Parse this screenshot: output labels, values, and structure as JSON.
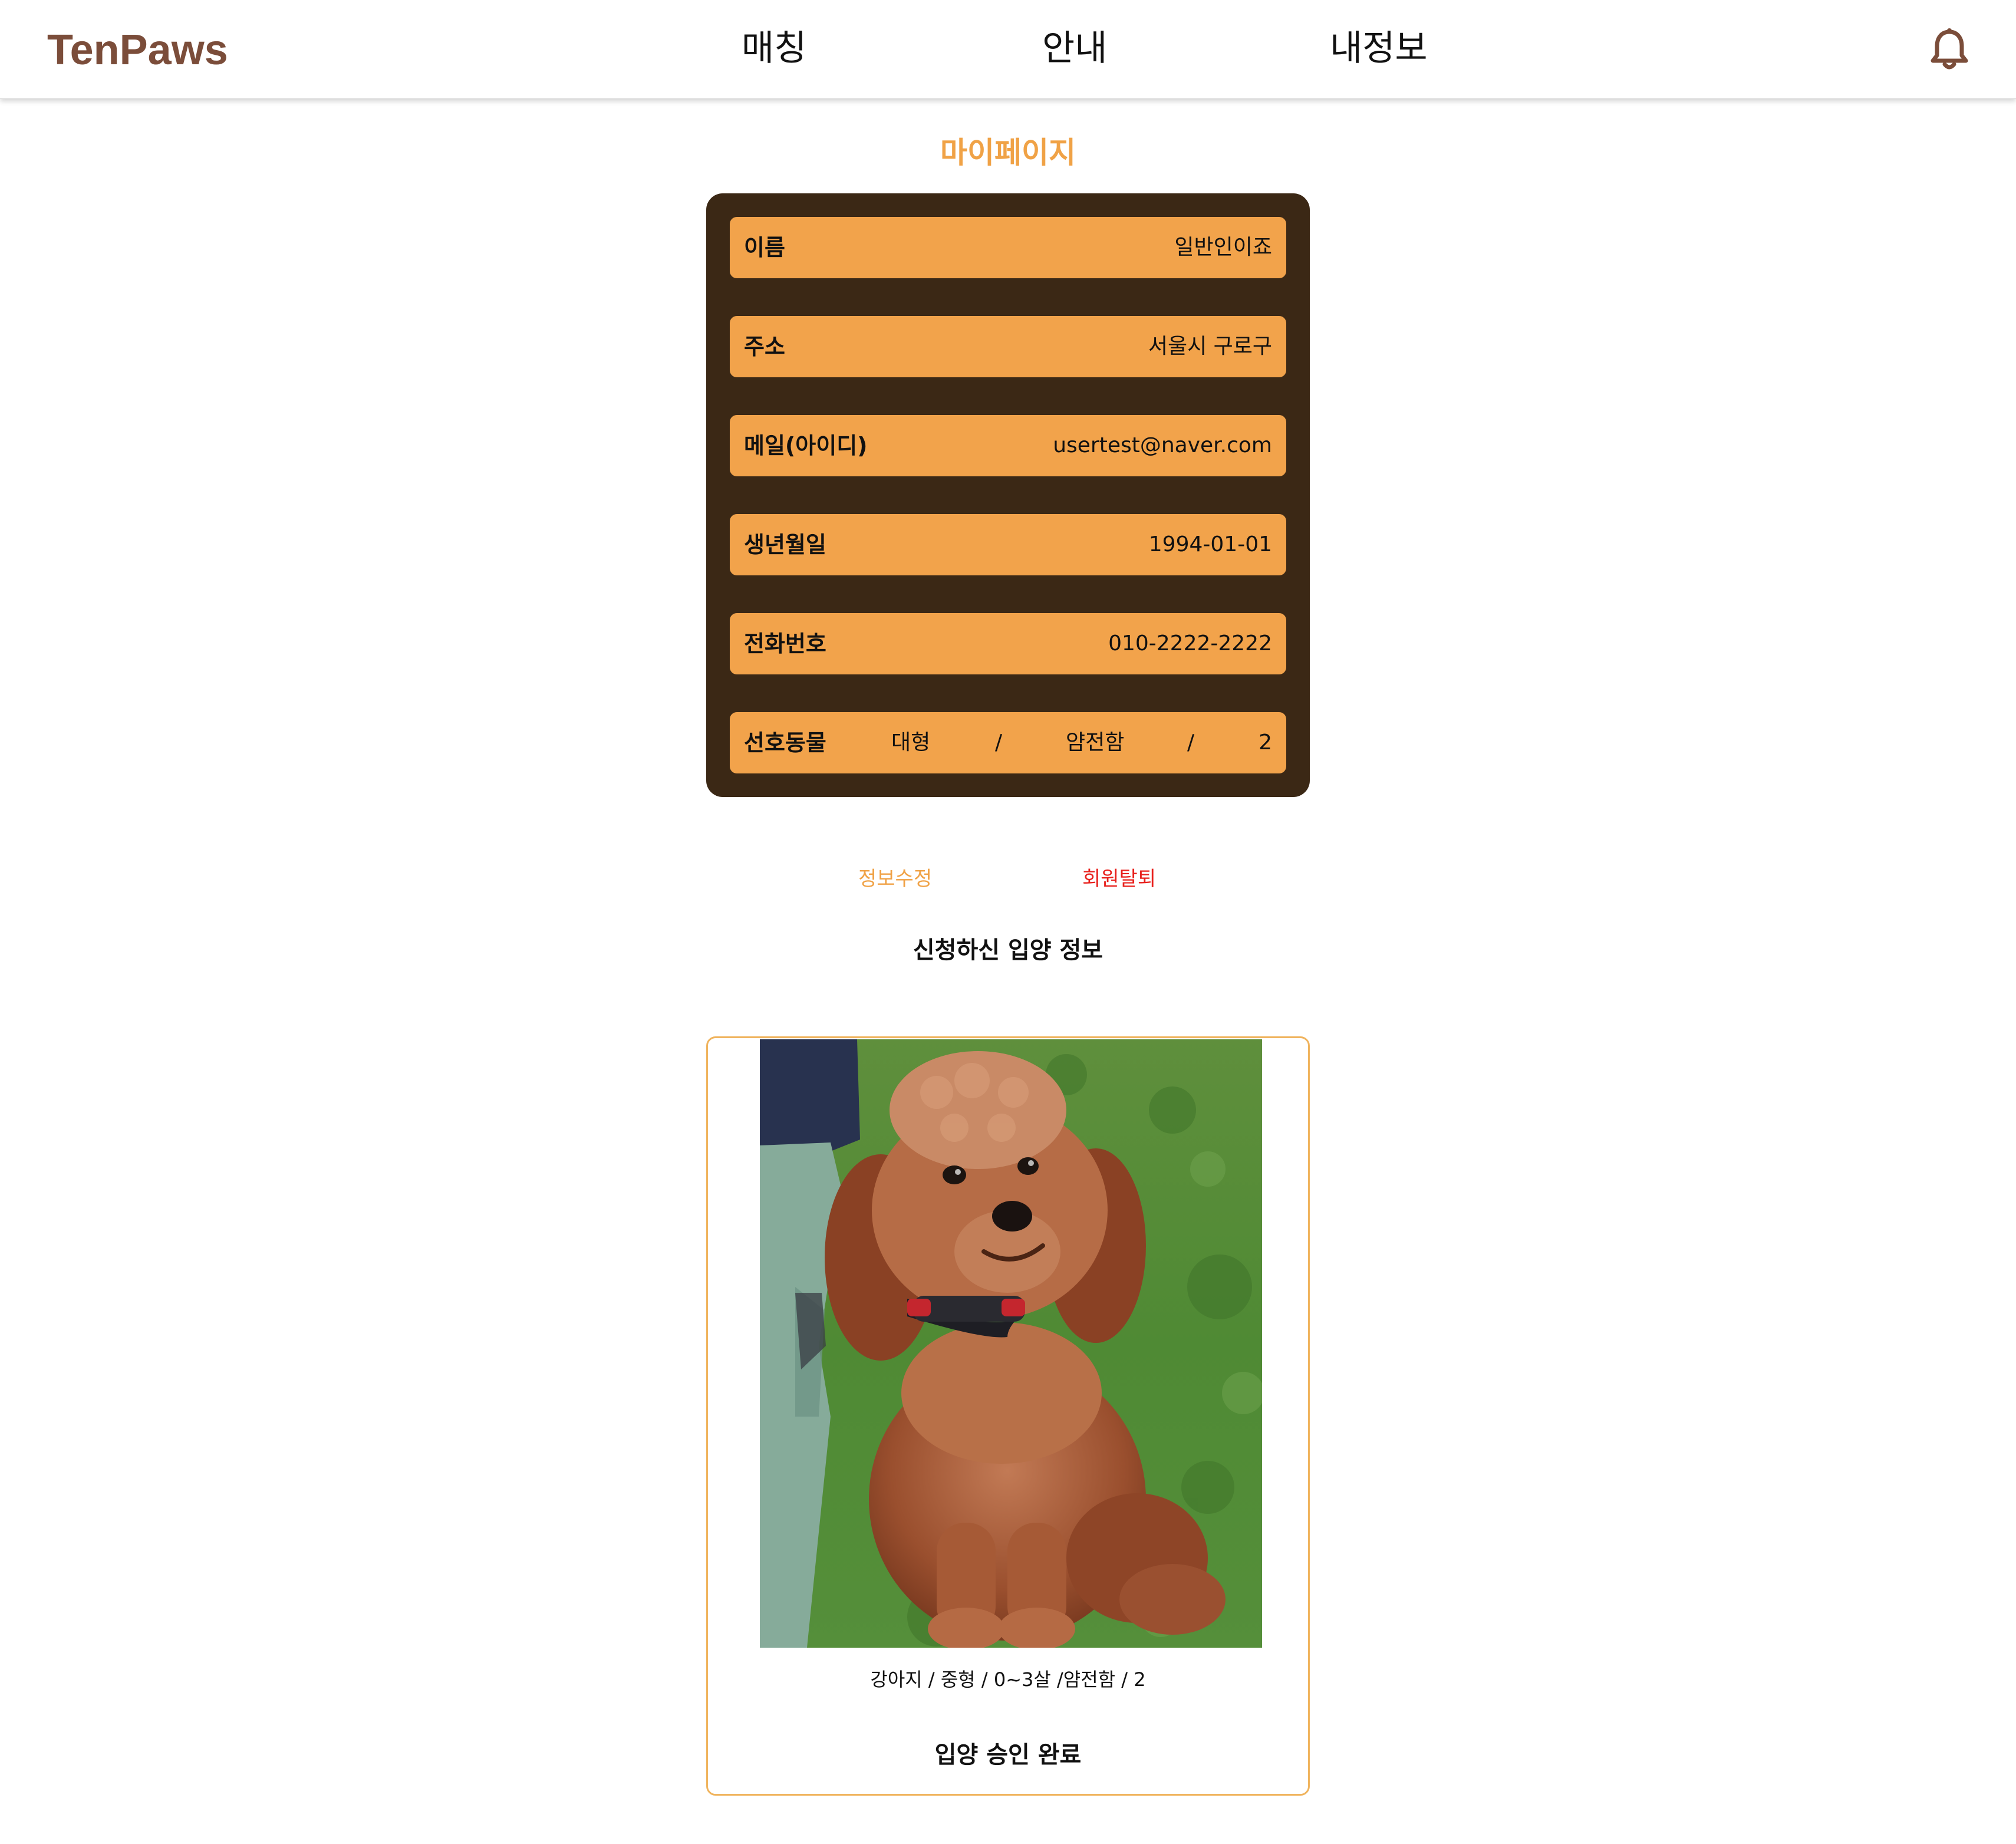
{
  "header": {
    "logo": "TenPaws",
    "nav": {
      "matching": "매칭",
      "guide": "안내",
      "my_info": "내정보"
    },
    "notification_icon": "bell-icon"
  },
  "page_title": "마이페이지",
  "profile": {
    "name": {
      "label": "이름",
      "value": "일반인이죠"
    },
    "address": {
      "label": "주소",
      "value": "서울시 구로구"
    },
    "email": {
      "label": "메일(아이디)",
      "value": "usertest@naver.com"
    },
    "birthdate": {
      "label": "생년월일",
      "value": "1994-01-01"
    },
    "phone": {
      "label": "전화번호",
      "value": "010-2222-2222"
    },
    "preferred_animal": {
      "label": "선호동물",
      "size": "대형",
      "separator": "/",
      "temperament": "얌전함",
      "count": "2"
    }
  },
  "actions": {
    "edit": "정보수정",
    "withdraw": "회원탈퇴"
  },
  "adoption": {
    "heading": "신청하신 입양 정보",
    "pet_description": "강아지 / 중형 / 0~3살 /얌전함 / 2",
    "status": "입양 승인 완료"
  },
  "colors": {
    "brand": "#7b4d3a",
    "accent": "#f0a246",
    "panel_bg": "#3b2815",
    "row_bg": "#f2a34b",
    "danger": "#e8201c"
  }
}
